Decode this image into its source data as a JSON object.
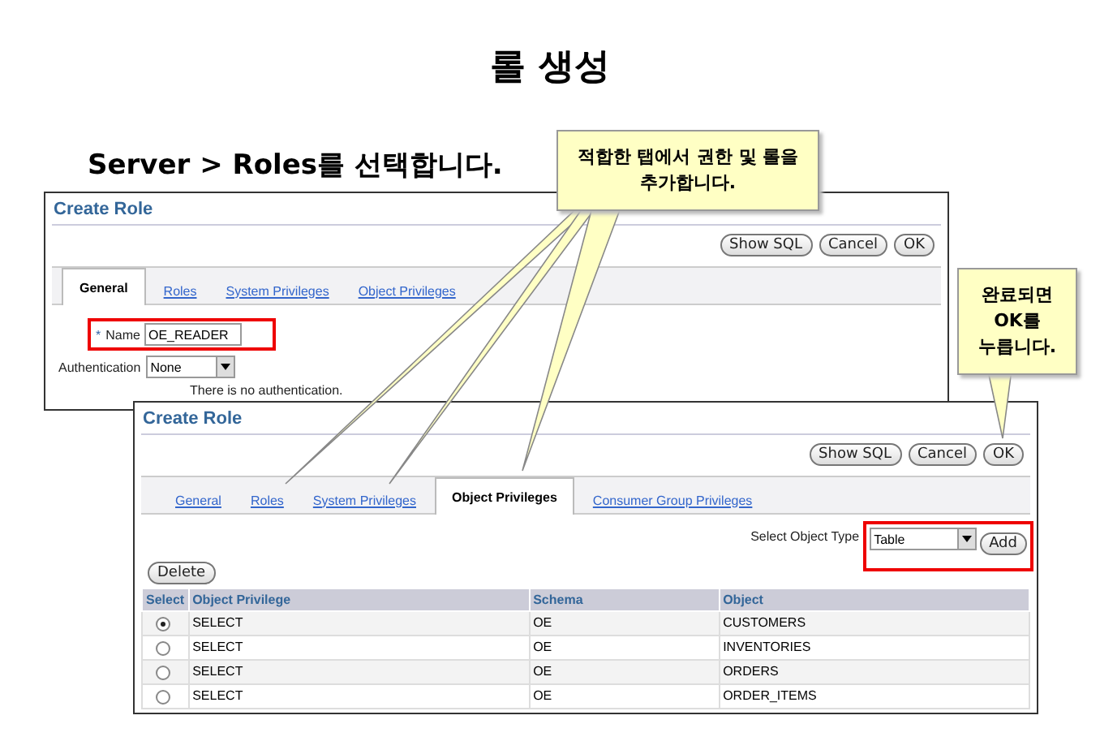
{
  "slide": {
    "title": "롤 생성",
    "subtitle": "Server > Roles를 선택합니다."
  },
  "back_window": {
    "title": "Create Role",
    "buttons": [
      "Show SQL",
      "Cancel",
      "OK"
    ],
    "tabs": [
      {
        "label": "General",
        "selected": true
      },
      {
        "label": "Roles",
        "selected": false
      },
      {
        "label": "System Privileges",
        "selected": false
      },
      {
        "label": "Object Privileges",
        "selected": false
      }
    ],
    "required_mark": "*",
    "name_label": "Name",
    "name_value": "OE_READER",
    "auth_label": "Authentication",
    "auth_value": "None",
    "auth_note": "There is no authentication."
  },
  "front_window": {
    "title": "Create Role",
    "buttons": [
      "Show SQL",
      "Cancel",
      "OK"
    ],
    "tabs": [
      {
        "label": "General",
        "selected": false
      },
      {
        "label": "Roles",
        "selected": false
      },
      {
        "label": "System Privileges",
        "selected": false
      },
      {
        "label": "Object Privileges",
        "selected": true
      },
      {
        "label": "Consumer Group Privileges",
        "selected": false
      }
    ],
    "object_type_label": "Select Object Type",
    "object_type_value": "Table",
    "add_button": "Add",
    "delete_button": "Delete",
    "table": {
      "columns": [
        "Select",
        "Object Privilege",
        "Schema",
        "Object"
      ],
      "rows": [
        {
          "selected": true,
          "privilege": "SELECT",
          "schema": "OE",
          "object": "CUSTOMERS"
        },
        {
          "selected": false,
          "privilege": "SELECT",
          "schema": "OE",
          "object": "INVENTORIES"
        },
        {
          "selected": false,
          "privilege": "SELECT",
          "schema": "OE",
          "object": "ORDERS"
        },
        {
          "selected": false,
          "privilege": "SELECT",
          "schema": "OE",
          "object": "ORDER_ITEMS"
        }
      ]
    }
  },
  "callouts": [
    {
      "lines": [
        "적합한 탭에서 권한 및 롤을",
        "추가합니다."
      ]
    },
    {
      "lines": [
        "완료되면",
        "OK를",
        "누릅니다."
      ]
    }
  ]
}
